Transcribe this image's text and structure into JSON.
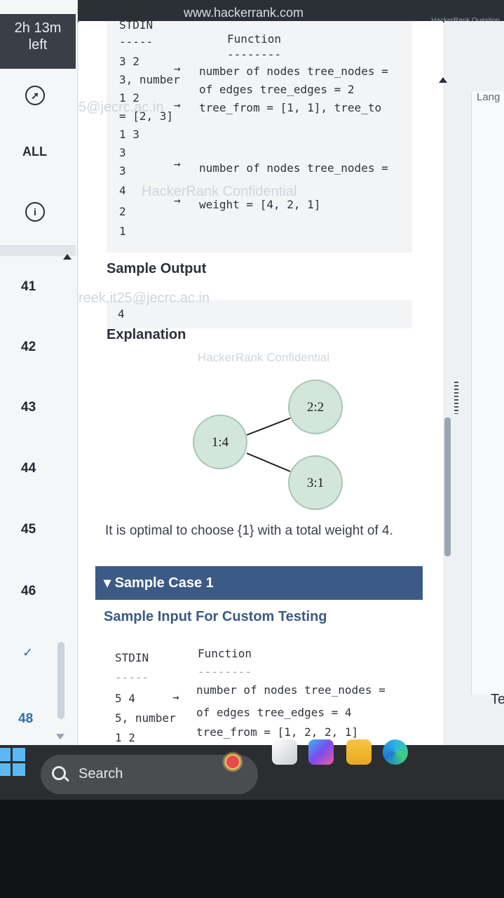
{
  "browser": {
    "url": "www.hackerrank.com",
    "top_right": "HackerRank Question"
  },
  "rail": {
    "timer_line1": "2h 13m",
    "timer_line2": "left",
    "all_label": "ALL",
    "items": [
      "41",
      "42",
      "43",
      "44",
      "45",
      "46",
      "48"
    ]
  },
  "sample0": {
    "stdin_header": "STDIN",
    "stdin_rule": "-----",
    "function_header": "Function",
    "function_rule": "--------",
    "arrow": "→",
    "rows": [
      {
        "in": "3 2",
        "fn": "number of nodes tree_nodes ="
      },
      {
        "in": "3, number",
        "fn": "of edges tree_edges = 2"
      },
      {
        "in": "1 2",
        "fn": "tree_from = [1, 1], tree_to"
      },
      {
        "in": "= [2, 3]",
        "fn": ""
      },
      {
        "in": "1 3",
        "fn": ""
      },
      {
        "in": "3",
        "fn": ""
      },
      {
        "in": "3",
        "fn": "number of nodes tree_nodes ="
      },
      {
        "in": "4",
        "fn": "weight = [4, 2, 1]"
      },
      {
        "in": "2",
        "fn": ""
      },
      {
        "in": "1",
        "fn": ""
      }
    ],
    "output_title": "Sample Output",
    "output_value": "4",
    "explanation_title": "Explanation",
    "graph_nodes": [
      "1:4",
      "2:2",
      "3:1"
    ],
    "explanation_text": "It is optimal to choose {1} with a total weight of 4."
  },
  "watermarks": [
    "5@jecrc.ac.in",
    "HackerRank Confidential",
    "reek.it25@jecrc.ac.in",
    "HackerRank Confidential"
  ],
  "case1": {
    "bar_label": "▾ Sample Case 1",
    "custom_title": "Sample Input For Custom Testing",
    "stdin_header": "STDIN",
    "function_header": "Function",
    "stdin_rule": "-----",
    "function_rule": "--------",
    "row1_in": "5 4",
    "row1_fn": "number of nodes tree_nodes =",
    "row2_in": "5, number",
    "row2_fn": "of edges tree_edges = 4",
    "row3_in": "1 2",
    "row3_fn": "tree_from = [1, 2, 2, 1]"
  },
  "editor": {
    "lang_label": "Lang",
    "te_label": "Te"
  },
  "taskbar": {
    "search_label": "Search"
  }
}
